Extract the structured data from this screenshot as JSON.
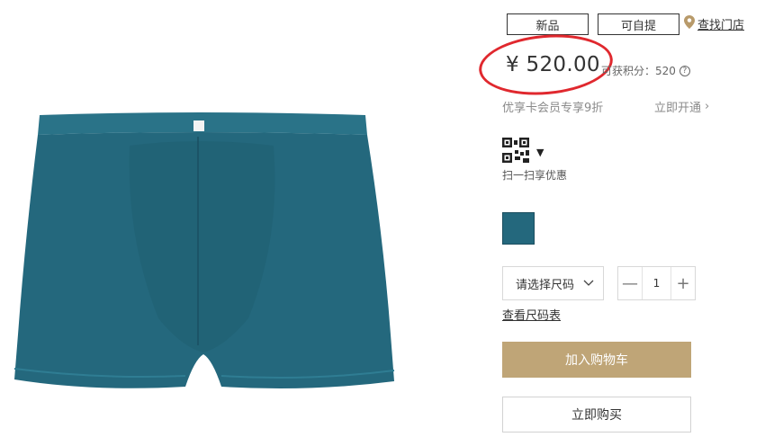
{
  "tags": {
    "new_label": "新品",
    "pickup_label": "可自提"
  },
  "store": {
    "label": "查找门店",
    "icon": "location-pin-icon",
    "icon_color": "#b89a6a"
  },
  "price": {
    "value": "¥ 520.00",
    "points_label": "可获积分：520",
    "points_help_icon": "question-icon"
  },
  "highlight": {
    "color": "#e0282e"
  },
  "member": {
    "text": "优享卡会员专享9折",
    "link_label": "立即开通"
  },
  "qr": {
    "icon": "qr-code-icon",
    "caption": "扫一扫享优惠"
  },
  "color_option": {
    "swatch_color": "#24687d"
  },
  "size": {
    "placeholder": "请选择尺码",
    "chart_link": "查看尺码表"
  },
  "quantity": {
    "value": "1",
    "minus": "—",
    "plus": "+"
  },
  "actions": {
    "add_to_cart": "加入购物车",
    "buy_now": "立即购买",
    "add_to_cart_color": "#bfa577"
  },
  "product": {
    "image": "teal-boxer-brief-image",
    "color": "#24687d"
  }
}
